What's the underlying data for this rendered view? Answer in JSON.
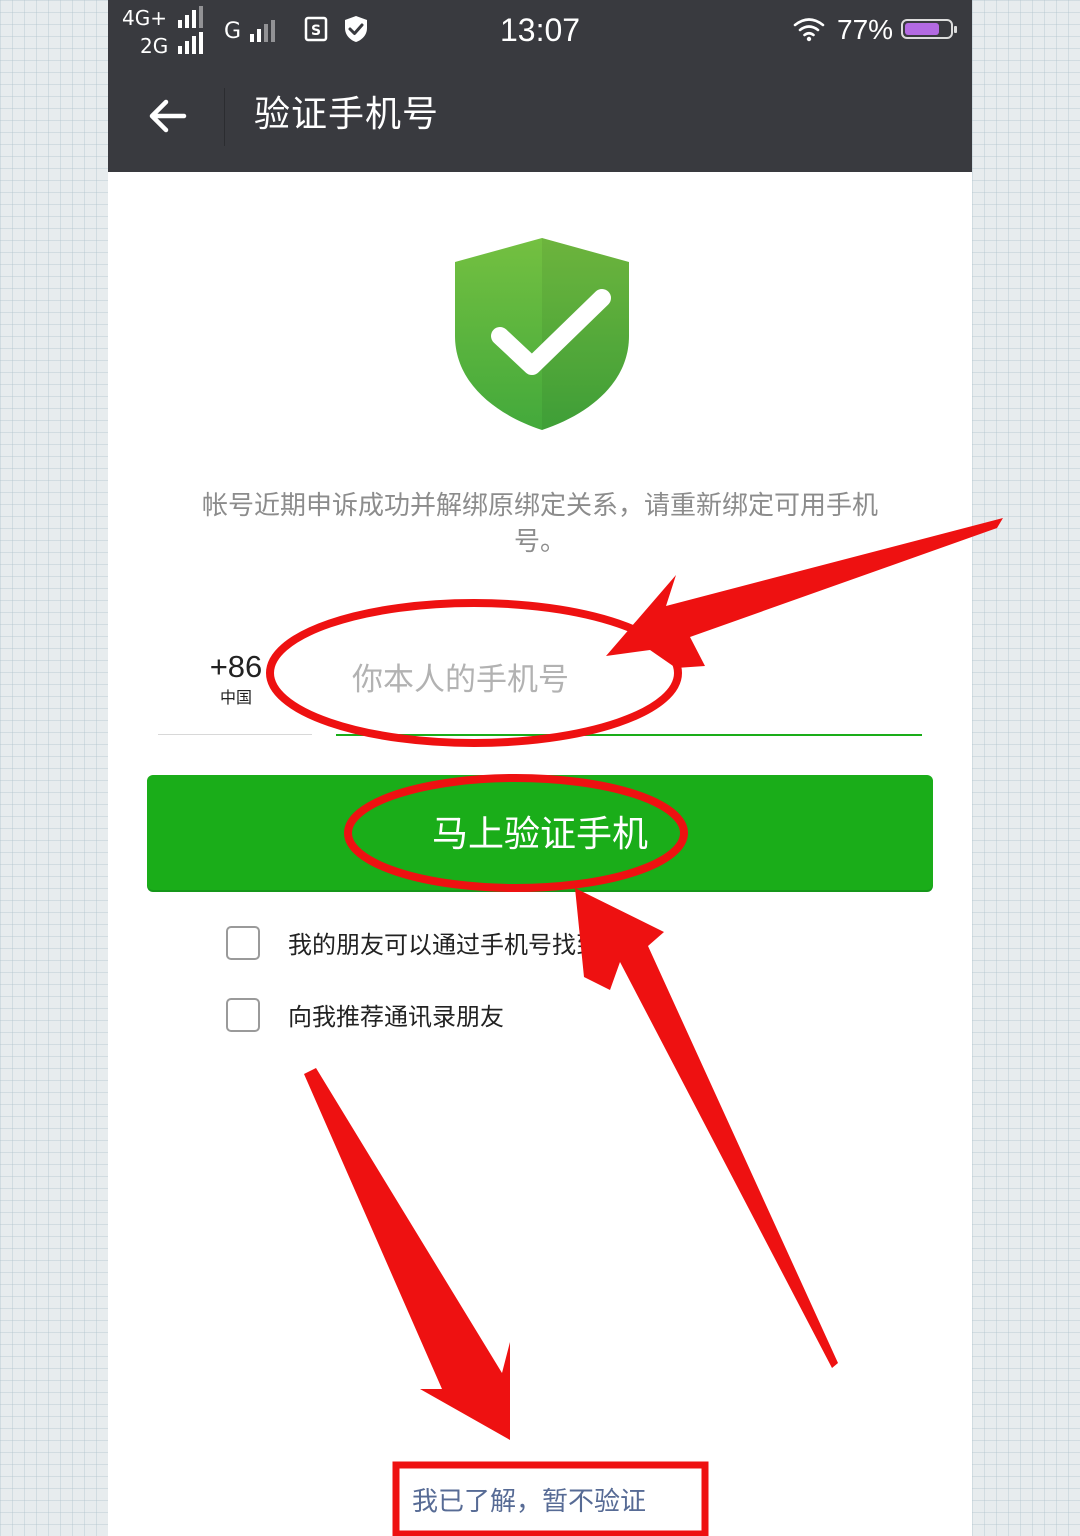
{
  "status_bar": {
    "net_primary": "4G+",
    "net_secondary": "2G",
    "net_g": "G",
    "time": "13:07",
    "battery_percent": "77%",
    "battery_level": 0.77,
    "icons": [
      "signal-bars-icon",
      "sim-icon",
      "vpn-shield-icon",
      "wifi-icon",
      "battery-icon"
    ]
  },
  "header": {
    "back_icon": "arrow-left-icon",
    "title": "验证手机号"
  },
  "main": {
    "shield_icon": "shield-check-icon",
    "hint_line1": "帐号近期申诉成功并解绑原绑定关系，请重新绑定可用手机",
    "hint_line2": "号。",
    "country_code": "+86",
    "country_name": "中国",
    "phone_input": {
      "placeholder": "你本人的手机号",
      "value": ""
    },
    "verify_button": "马上验证手机",
    "options": [
      {
        "label": "我的朋友可以通过手机号找到我",
        "checked": false
      },
      {
        "label": "向我推荐通讯录朋友",
        "checked": false
      }
    ],
    "skip_link": "我已了解，暂不验证"
  },
  "colors": {
    "bar_bg": "#393a3f",
    "primary_green": "#1aad19",
    "link_blue": "#576b95",
    "annotation_red": "#ee1111"
  }
}
